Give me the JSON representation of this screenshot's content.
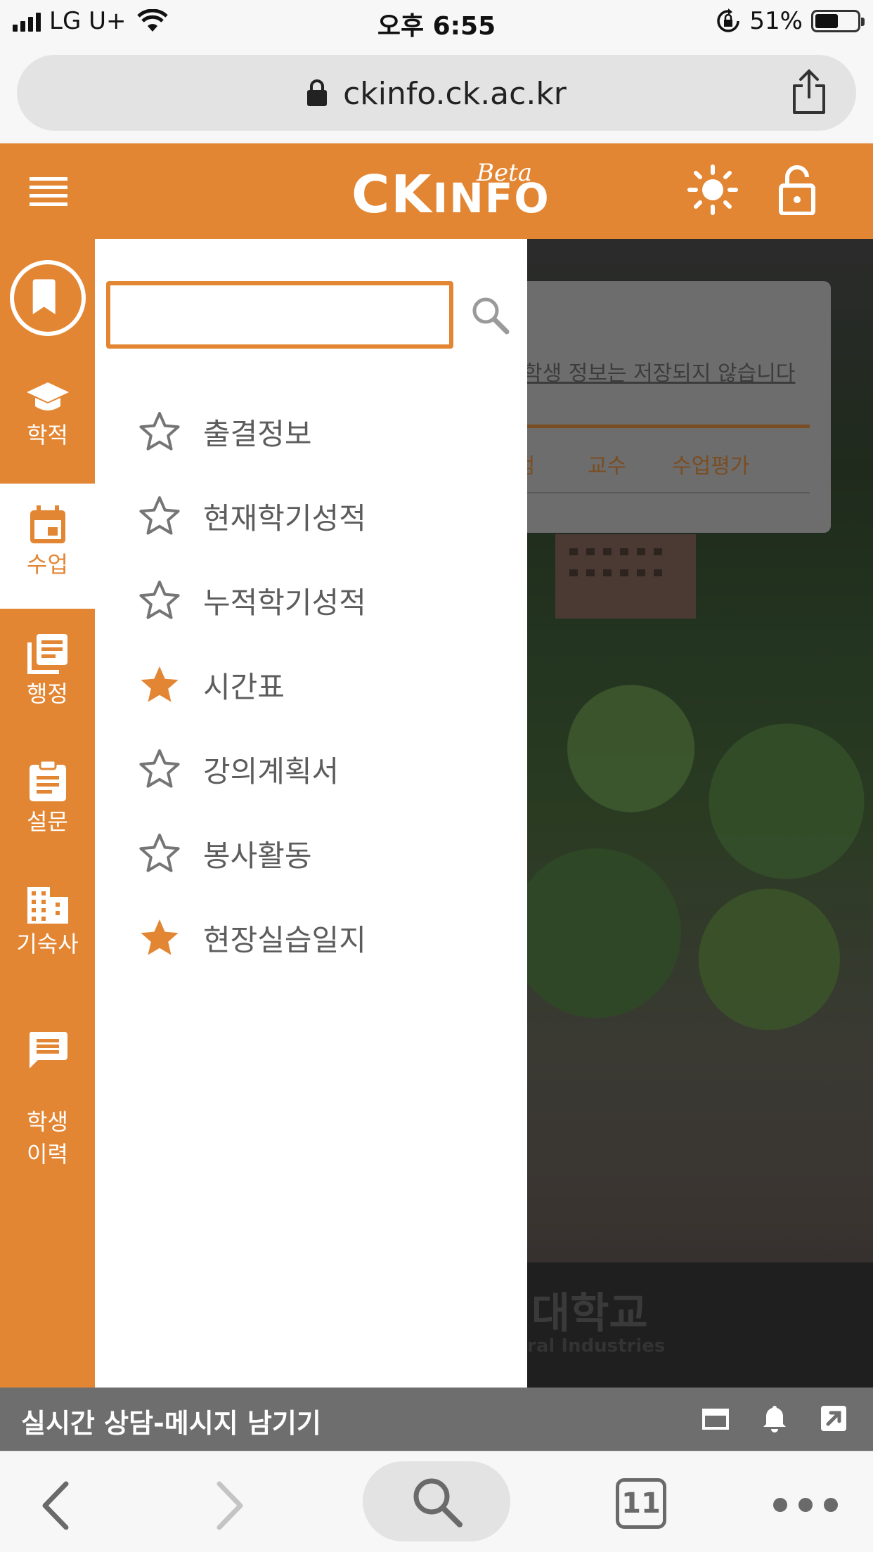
{
  "status_bar": {
    "carrier": "LG U+",
    "time": "오후 6:55",
    "battery": "51%"
  },
  "browser": {
    "url": "ckinfo.ck.ac.kr",
    "tab_count": "11"
  },
  "header": {
    "logo_main": "CK",
    "logo_rest": "INFO",
    "logo_badge": "Beta",
    "brand_color": "#e38633"
  },
  "rail": {
    "items": [
      {
        "label": "학적",
        "icon": "graduation-cap-icon"
      },
      {
        "label": "수업",
        "icon": "calendar-icon",
        "active": true
      },
      {
        "label": "행정",
        "icon": "documents-icon"
      },
      {
        "label": "설문",
        "icon": "clipboard-icon"
      },
      {
        "label": "기숙사",
        "icon": "building-icon"
      },
      {
        "label": "학생\n이력",
        "icon": "message-icon"
      }
    ]
  },
  "drawer": {
    "search_value": "",
    "items": [
      {
        "label": "출결정보",
        "starred": false
      },
      {
        "label": "현재학기성적",
        "starred": false
      },
      {
        "label": "누적학기성적",
        "starred": false
      },
      {
        "label": "시간표",
        "starred": true
      },
      {
        "label": "강의계획서",
        "starred": false
      },
      {
        "label": "봉사활동",
        "starred": false
      },
      {
        "label": "현장실습일지",
        "starred": true
      }
    ]
  },
  "background_page": {
    "notice": "학생 정보는 저장되지 않습니다",
    "tabs": [
      "학점",
      "교수",
      "수업평가"
    ],
    "footer_kor": "대학교",
    "footer_eng": "ral Industries"
  },
  "chat_banner": {
    "title": "실시간 상담-메시지 남기기"
  }
}
